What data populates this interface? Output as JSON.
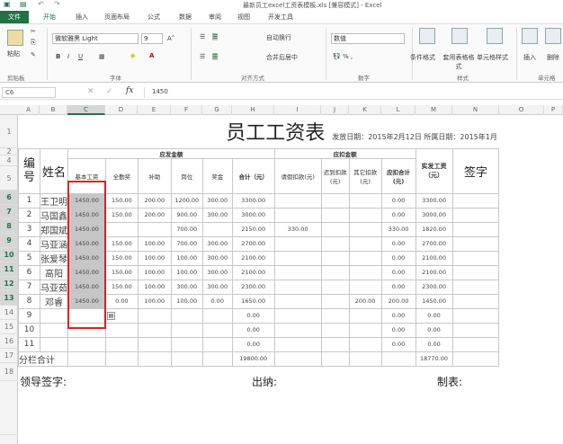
{
  "window": {
    "title": "最新员工excel工资表模板.xls  [兼容模式] - Excel"
  },
  "tabs": [
    "文件",
    "开始",
    "插入",
    "页面布局",
    "公式",
    "数据",
    "审阅",
    "视图",
    "开发工具"
  ],
  "ribbon": {
    "paste": "粘贴",
    "font_name": "微软雅黑 Light",
    "font_size": "9",
    "wrap_text": "自动换行",
    "merge_center": "合并后居中",
    "number_format": "数值",
    "conditional_format": "条件格式",
    "table_format": "套用表格格式",
    "cell_styles": "单元格样式",
    "insert": "插入",
    "delete": "删除",
    "groups": [
      "剪贴板",
      "字体",
      "对齐方式",
      "数字",
      "样式",
      "单元格"
    ]
  },
  "formula_bar": {
    "name_box": "C6",
    "fx": "fx",
    "value": "1450"
  },
  "columns": [
    "A",
    "B",
    "C",
    "D",
    "E",
    "F",
    "G",
    "H",
    "I",
    "J",
    "K",
    "L",
    "M",
    "N",
    "O",
    "P"
  ],
  "row_numbers": [
    "1",
    "2",
    "4",
    "5",
    "6",
    "7",
    "8",
    "9",
    "10",
    "11",
    "12",
    "13",
    "14",
    "15",
    "16",
    "17",
    "18",
    ""
  ],
  "sheet": {
    "title": "员工工资表",
    "issue_date": "发放日期：2015年2月12日 所属日期：2015年1月",
    "h_no": "编号",
    "h_name": "姓名",
    "h_payable": "应发金额",
    "h_deduct": "应扣金额",
    "h_net": "实发工资（元）",
    "h_sign": "签字",
    "sub": [
      "基本工资",
      "全勤奖",
      "补助",
      "岗位",
      "奖金",
      "合计（元）",
      "请假扣款(元)",
      "迟到扣款(元)",
      "其它扣款(元)",
      "应扣合计(元)"
    ],
    "rows": [
      [
        "1",
        "王卫明",
        "1450.00",
        "150.00",
        "200.00",
        "1200.00",
        "300.00",
        "3300.00",
        "",
        "",
        "",
        "0.00",
        "3300.00"
      ],
      [
        "2",
        "马国鑫",
        "1450.00",
        "150.00",
        "200.00",
        "900.00",
        "300.00",
        "3000.00",
        "",
        "",
        "",
        "0.00",
        "3000.00"
      ],
      [
        "3",
        "郑国斌",
        "1450.00",
        "",
        "",
        "700.00",
        "",
        "2150.00",
        "330.00",
        "",
        "",
        "330.00",
        "1820.00"
      ],
      [
        "4",
        "马亚涵",
        "1450.00",
        "150.00",
        "100.00",
        "700.00",
        "300.00",
        "2700.00",
        "",
        "",
        "",
        "0.00",
        "2700.00"
      ],
      [
        "5",
        "张爱琴",
        "1450.00",
        "150.00",
        "100.00",
        "100.00",
        "300.00",
        "2100.00",
        "",
        "",
        "",
        "0.00",
        "2100.00"
      ],
      [
        "6",
        "高阳",
        "1450.00",
        "150.00",
        "100.00",
        "100.00",
        "300.00",
        "2100.00",
        "",
        "",
        "",
        "0.00",
        "2100.00"
      ],
      [
        "7",
        "马亚茹",
        "1450.00",
        "150.00",
        "100.00",
        "300.00",
        "300.00",
        "2300.00",
        "",
        "",
        "",
        "0.00",
        "2300.00"
      ],
      [
        "8",
        "邓睿",
        "1450.00",
        "0.00",
        "100.00",
        "100.00",
        "0.00",
        "1650.00",
        "",
        "",
        "200.00",
        "200.00",
        "1450.00"
      ],
      [
        "9",
        "",
        "",
        "",
        "",
        "",
        "",
        "0.00",
        "",
        "",
        "",
        "0.00",
        "0.00"
      ],
      [
        "10",
        "",
        "",
        "",
        "",
        "",
        "",
        "0.00",
        "",
        "",
        "",
        "0.00",
        "0.00"
      ],
      [
        "11",
        "",
        "",
        "",
        "",
        "",
        "",
        "0.00",
        "",
        "",
        "",
        "0.00",
        "0.00"
      ]
    ],
    "subtotal_label": "分栏合计",
    "subtotal_payable": "19800.00",
    "subtotal_net": "18770.00",
    "leader_sign": "领导签字:",
    "cashier": "出纳:",
    "preparer": "制表:"
  }
}
